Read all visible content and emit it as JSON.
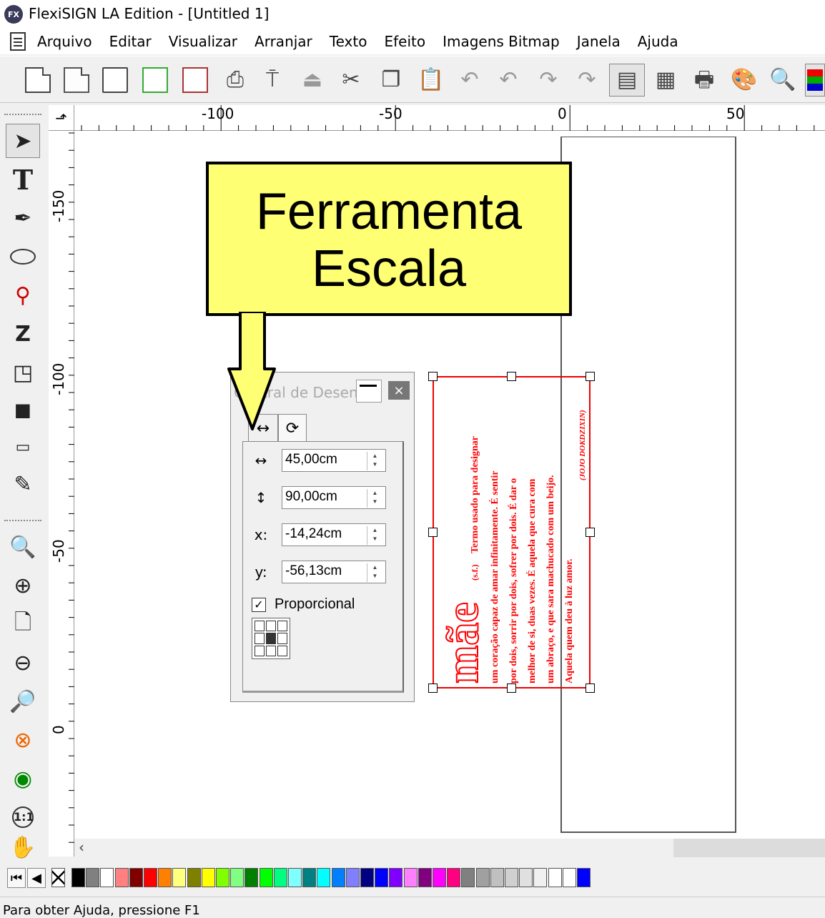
{
  "window": {
    "logo": "FX",
    "title": "FlexiSIGN LA Edition - [Untitled 1]"
  },
  "menu": [
    "Arquivo",
    "Editar",
    "Visualizar",
    "Arranjar",
    "Texto",
    "Efeito",
    "Imagens Bitmap",
    "Janela",
    "Ajuda"
  ],
  "toolbar_icons": [
    "new-icon",
    "open-icon",
    "save-icon",
    "save-as-icon",
    "export-icon",
    "print-icon",
    "cut-tool-icon",
    "send-icon",
    "cut-icon",
    "copy-icon",
    "paste-icon",
    "undo-icon",
    "undo-list-icon",
    "redo-icon",
    "redo-list-icon",
    "design-central-icon",
    "job-info-icon",
    "production-manager-icon",
    "color-palette-icon",
    "color-picker-icon",
    "color-swatch-icon"
  ],
  "ruler": {
    "corner_icon": "ruler-origin-icon",
    "top_labels": [
      "-100",
      "-50",
      "0",
      "50"
    ],
    "left_labels": [
      "-150",
      "-100",
      "-50",
      "0"
    ]
  },
  "tools": [
    "pointer-icon",
    "text-tool-icon",
    "pen-tool-icon",
    "ellipse-tool-icon",
    "node-tool-icon",
    "distortion-tool-icon",
    "shape-tool-icon",
    "extrude-tool-icon",
    "measure-tool-icon",
    "eyedropper-icon",
    "zoom-window-icon",
    "zoom-in-icon",
    "zoom-page-icon",
    "zoom-out-icon",
    "zoom-all-icon",
    "zoom-selection-icon",
    "zoom-previous-icon",
    "zoom-actual-size-icon",
    "pan-hand-icon"
  ],
  "callout": {
    "line1": "Ferramenta",
    "line2": "Escala"
  },
  "dialog": {
    "title": "Central de Desenho",
    "close_symbol": "×",
    "tabs": [
      "scale-tab-icon",
      "rotate-tab-icon"
    ],
    "tab_symbols": [
      "↔",
      "⟳"
    ],
    "fields": [
      {
        "icon": "↔",
        "icon_name": "width-icon",
        "value": "45,00cm"
      },
      {
        "icon": "↕",
        "icon_name": "height-icon",
        "value": "90,00cm"
      },
      {
        "icon": "x:",
        "icon_name": "x-label",
        "value": "-14,24cm"
      },
      {
        "icon": "y:",
        "icon_name": "y-label",
        "value": "-56,13cm"
      }
    ],
    "proportional_checked": true,
    "check_mark": "✓",
    "proportional_label": "Proporcional"
  },
  "object": {
    "color": "#ff0000",
    "title_word": "mãe",
    "phonetic": "(s.f.)",
    "lines": [
      "Termo usado para designar",
      "um coração capaz de amar infinitamente. É sentir",
      "por dois, sorrir por dois, sofrer por dois. É dar o",
      "melhor de si, duas vezes. É aquela que cura com",
      "um abraço, e que sara machucado com um beijo.",
      "Aquela quem deu à luz amor."
    ],
    "credit": "(JOJO DOKDZIXIN)"
  },
  "scroll": {
    "left_arrow": "‹"
  },
  "palette": {
    "nav": [
      "⏮",
      "◀"
    ],
    "none_swatch": "none-swatch",
    "colors": [
      "#000000",
      "#808080",
      "#ffffff",
      "#ff8080",
      "#800000",
      "#ff0000",
      "#ff8000",
      "#ffff80",
      "#808000",
      "#ffff00",
      "#80ff00",
      "#80ff80",
      "#008000",
      "#00ff00",
      "#00ff80",
      "#80ffff",
      "#008080",
      "#00ffff",
      "#0080ff",
      "#8080ff",
      "#000080",
      "#0000ff",
      "#8000ff",
      "#ff80ff",
      "#800080",
      "#ff00ff",
      "#ff0080",
      "#808080",
      "#a0a0a0",
      "#c0c0c0",
      "#d0d0d0",
      "#e0e0e0",
      "#f0f0f0",
      "#ffffff",
      "#ffffff",
      "#0000ff"
    ]
  },
  "status": "Para obter Ajuda, pressione F1"
}
